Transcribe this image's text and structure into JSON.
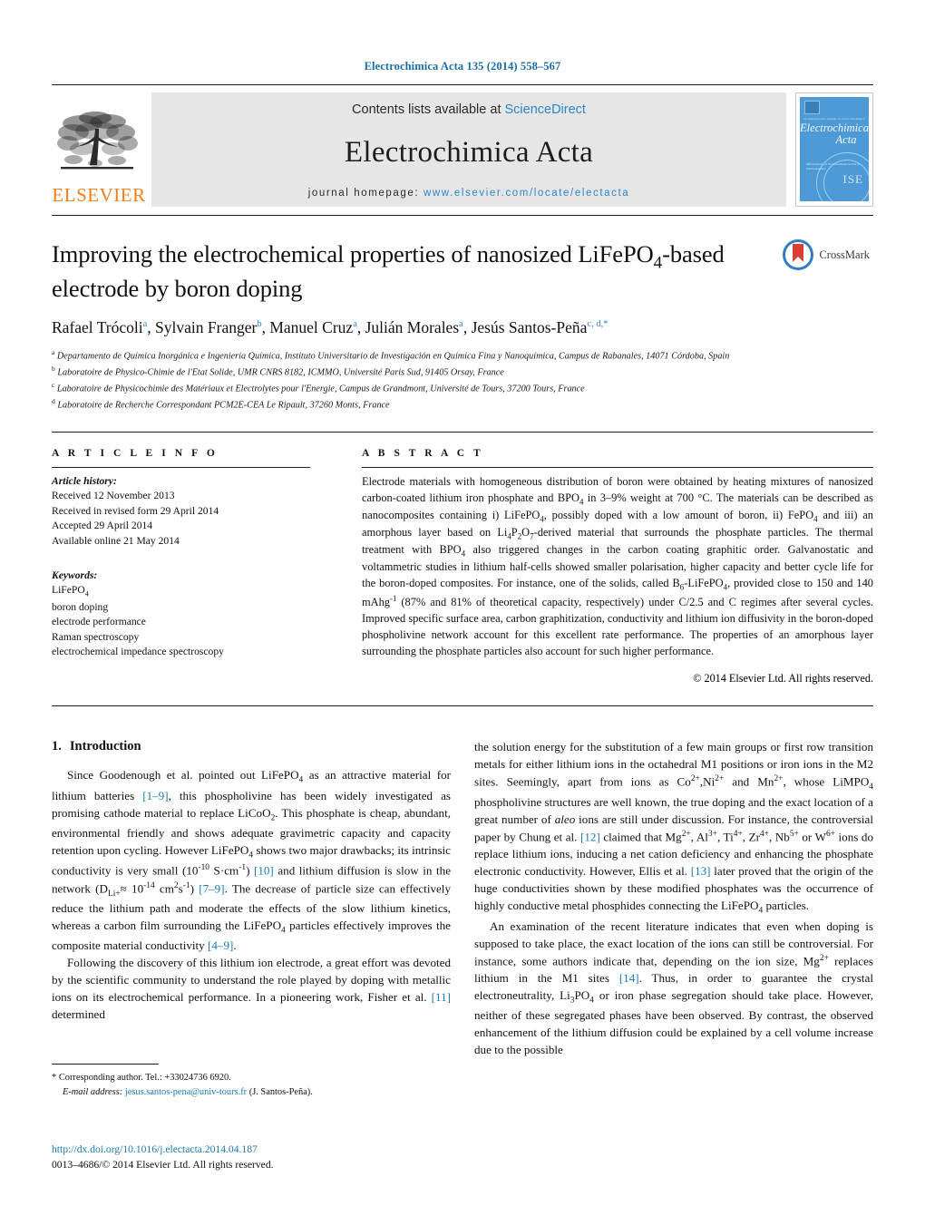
{
  "running_head": "Electrochimica Acta 135 (2014) 558–567",
  "masthead": {
    "publisher_name": "ELSEVIER",
    "contents_prefix": "Contents lists available at ",
    "contents_link": "ScienceDirect",
    "journal_title": "Electrochimica Acta",
    "homepage_prefix": "journal homepage: ",
    "homepage_url": "www.elsevier.com/locate/electacta",
    "cover": {
      "strap": "an international journal of electrochemistry",
      "title_line1": "Electrochimica",
      "title_line2": "Acta",
      "small_text": "Official journal of the\nInternational Society of Electrochemistry",
      "seal_text": "ISE"
    }
  },
  "article": {
    "title": "Improving the electrochemical properties of nanosized LiFePO4-based electrode by boron doping",
    "title_part1": "Improving the electrochemical properties of nanosized LiFePO",
    "title_sub": "4",
    "title_part2": "-based electrode by boron doping",
    "crossmark_label": "CrossMark",
    "authors": [
      {
        "name": "Rafael Trócoli",
        "marks": "a"
      },
      {
        "name": "Sylvain Franger",
        "marks": "b"
      },
      {
        "name": "Manuel Cruz",
        "marks": "a"
      },
      {
        "name": "Julián Morales",
        "marks": "a"
      },
      {
        "name": "Jesús Santos-Peña",
        "marks": "c, d,"
      }
    ],
    "affiliations": [
      {
        "mark": "a",
        "text": "Departamento de Química Inorgánica e Ingeniería Química, Instituto Universitario de Investigación en Química Fina y Nanoquímica, Campus de Rabanales, 14071 Córdoba, Spain"
      },
      {
        "mark": "b",
        "text": "Laboratoire de Physico-Chimie de l'Etat Solide, UMR CNRS 8182, ICMMO, Université Paris Sud, 91405 Orsay, France"
      },
      {
        "mark": "c",
        "text": "Laboratoire de Physicochimie des Matériaux et Electrolytes pour l'Energie, Campus de Grandmont, Université de Tours, 37200 Tours, France"
      },
      {
        "mark": "d",
        "text": "Laboratoire de Recherche Correspondant PCM2E-CEA Le Ripault, 37260 Monts, France"
      }
    ]
  },
  "article_info": {
    "heading": "A R T I C L E    I N F O",
    "history_label": "Article history:",
    "history": [
      "Received 12 November 2013",
      "Received in revised form 29 April 2014",
      "Accepted 29 April 2014",
      "Available online 21 May 2014"
    ],
    "keywords_label": "Keywords:",
    "keywords": [
      "LiFePO4",
      "boron doping",
      "electrode performance",
      "Raman spectroscopy",
      "electrochemical impedance spectroscopy"
    ]
  },
  "abstract": {
    "heading": "A B S T R A C T",
    "text": "Electrode materials with homogeneous distribution of boron were obtained by heating mixtures of nanosized carbon-coated lithium iron phosphate and BPO4 in 3–9% weight at 700 °C. The materials can be described as nanocomposites containing i) LiFePO4, possibly doped with a low amount of boron, ii) FePO4 and iii) an amorphous layer based on Li4P2O7-derived material that surrounds the phosphate particles. The thermal treatment with BPO4 also triggered changes in the carbon coating graphitic order. Galvanostatic and voltammetric studies in lithium half-cells showed smaller polarisation, higher capacity and better cycle life for the boron-doped composites. For instance, one of the solids, called B6-LiFePO4, provided close to 150 and 140 mAhg-1 (87% and 81% of theoretical capacity, respectively) under C/2.5 and C regimes after several cycles. Improved specific surface area, carbon graphitization, conductivity and lithium ion diffusivity in the boron-doped phospholivine network account for this excellent rate performance. The properties of an amorphous layer surrounding the phosphate particles also account for such higher performance.",
    "copyright": "© 2014 Elsevier Ltd. All rights reserved."
  },
  "section": {
    "number": "1.",
    "title": "Introduction"
  },
  "body": {
    "left_p1": "Since Goodenough et al. pointed out LiFePO4 as an attractive material for lithium batteries [1–9], this phospholivine has been widely investigated as promising cathode material to replace LiCoO2. This phosphate is cheap, abundant, environmental friendly and shows adequate gravimetric capacity and capacity retention upon cycling. However LiFePO4 shows two major drawbacks; its intrinsic conductivity is very small (10-10 S·cm-1) [10] and lithium diffusion is slow in the network (DLi+≈ 10-14 cm2s-1) [7–9]. The decrease of particle size can effectively reduce the lithium path and moderate the effects of the slow lithium kinetics, whereas a carbon film surrounding the LiFePO4 particles effectively improves the composite material conductivity [4–9].",
    "left_p2": "Following the discovery of this lithium ion electrode, a great effort was devoted by the scientific community to understand the role played by doping with metallic ions on its electrochemical performance. In a pioneering work, Fisher et al. [11] determined",
    "right_p1": "the solution energy for the substitution of a few main groups or first row transition metals for either lithium ions in the octahedral M1 positions or iron ions in the M2 sites. Seemingly, apart from ions as Co2+,Ni2+ and Mn2+, whose LiMPO4 phospholivine structures are well known, the true doping and the exact location of a great number of aleo ions are still under discussion. For instance, the controversial paper by Chung et al. [12] claimed that Mg2+, Al3+, Ti4+, Zr4+, Nb5+ or W6+ ions do replace lithium ions, inducing a net cation deficiency and enhancing the phosphate electronic conductivity. However, Ellis et al. [13] later proved that the origin of the huge conductivities shown by these modified phosphates was the occurrence of highly conductive metal phosphides connecting the LiFePO4 particles.",
    "right_p2": "An examination of the recent literature indicates that even when doping is supposed to take place, the exact location of the ions can still be controversial. For instance, some authors indicate that, depending on the ion size, Mg2+ replaces lithium in the M1 sites [14]. Thus, in order to guarantee the crystal electroneutrality, Li3PO4 or iron phase segregation should take place. However, neither of these segregated phases have been observed. By contrast, the observed enhancement of the lithium diffusion could be explained by a cell volume increase due to the possible"
  },
  "footnote": {
    "marker": "*",
    "corresponding": "Corresponding author. Tel.: +33024736 6920.",
    "email_label": "E-mail address:",
    "email": "jesus.santos-pena@univ-tours.fr",
    "email_suffix": "(J. Santos-Peña)."
  },
  "footer": {
    "doi": "http://dx.doi.org/10.1016/j.electacta.2014.04.187",
    "issn_line": "0013–4686/© 2014 Elsevier Ltd. All rights reserved."
  },
  "colors": {
    "link_blue": "#1a7bb0",
    "header_blue": "#1a6ea8",
    "elsevier_orange": "#F07F1A",
    "band_gray": "#e6e6e6",
    "cover_blue": "#4d9ad6"
  }
}
